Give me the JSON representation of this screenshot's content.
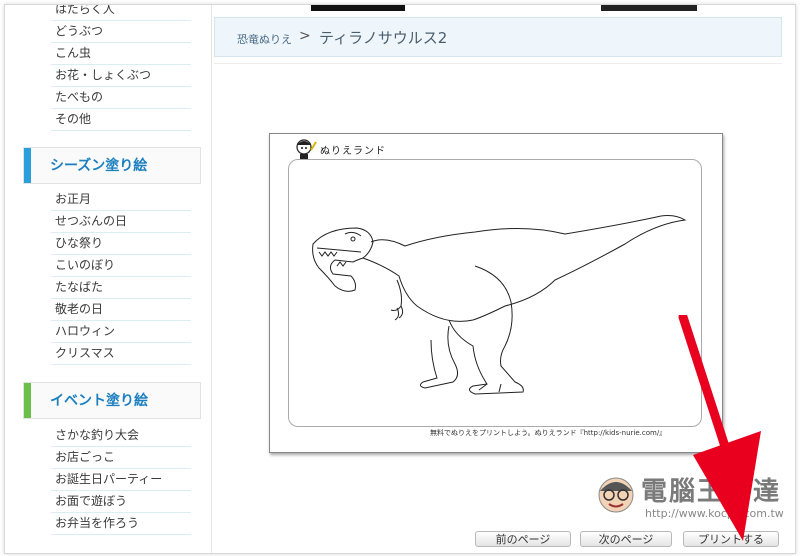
{
  "sidebar": {
    "list_top": [
      {
        "label": "はたらく人"
      },
      {
        "label": "どうぶつ"
      },
      {
        "label": "こん虫"
      },
      {
        "label": "お花・しょくぶつ"
      },
      {
        "label": "たべもの"
      },
      {
        "label": "その他"
      }
    ],
    "season": {
      "heading": "シーズン塗り絵",
      "accent": "#2a9fdc",
      "items": [
        {
          "label": "お正月"
        },
        {
          "label": "せつぶんの日"
        },
        {
          "label": "ひな祭り"
        },
        {
          "label": "こいのぼり"
        },
        {
          "label": "たなばた"
        },
        {
          "label": "敬老の日"
        },
        {
          "label": "ハロウィン"
        },
        {
          "label": "クリスマス"
        }
      ]
    },
    "event": {
      "heading": "イベント塗り絵",
      "accent": "#6cc04a",
      "items": [
        {
          "label": "さかな釣り大会"
        },
        {
          "label": "お店ごっこ"
        },
        {
          "label": "お誕生日パーティー"
        },
        {
          "label": "お面で遊ぼう"
        },
        {
          "label": "お弁当を作ろう"
        }
      ]
    }
  },
  "breadcrumb": {
    "parent": "恐竜ぬりえ",
    "separator": ">",
    "title": "ティラノサウルス2"
  },
  "sheet": {
    "brand": "ぬりえランド",
    "footer": "無料でぬりえをプリントしよう。ぬりえランド『http://kids-nurie.com/』"
  },
  "watermark": {
    "title": "電腦王阿達",
    "url": "http://www.kocpc.com.tw"
  },
  "pager": {
    "prev": "前のページ",
    "next": "次のページ",
    "print": "プリントする"
  },
  "colors": {
    "arrow": "#e8001e",
    "crumb_bg": "#eef6fb"
  }
}
